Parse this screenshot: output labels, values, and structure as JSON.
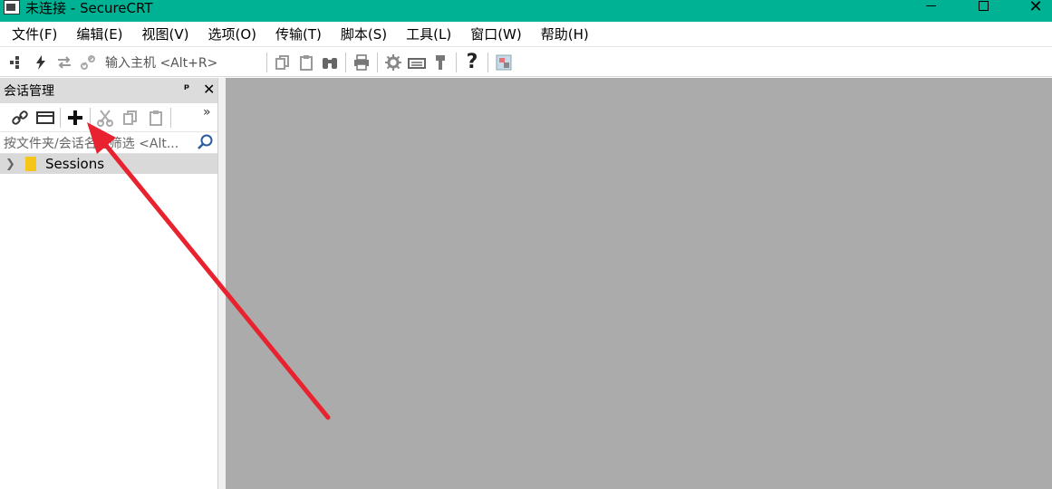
{
  "window": {
    "title": "未连接 - SecureCRT"
  },
  "menu": [
    "文件(F)",
    "编辑(E)",
    "视图(V)",
    "选项(O)",
    "传输(T)",
    "脚本(S)",
    "工具(L)",
    "窗口(W)",
    "帮助(H)"
  ],
  "toolbar": {
    "host_placeholder": "输入主机 <Alt+R>",
    "help_glyph": "?"
  },
  "session_panel": {
    "title": "会话管理",
    "pin_glyph": "ᵖ",
    "close_glyph": "✕",
    "more_glyph": "»",
    "filter_placeholder": "按文件夹/会话名称筛选 <Alt...",
    "tree": [
      {
        "label": "Sessions"
      }
    ]
  },
  "colors": {
    "titlebar": "#00b294",
    "workspace": "#ababab",
    "annotation_arrow": "#e8222e"
  },
  "icons": [
    "connect-icon",
    "flash-icon",
    "reconnect-icon",
    "disconnect-icon",
    "copy-icon",
    "paste-icon",
    "find-icon",
    "print-icon",
    "settings-icon",
    "keymap-icon",
    "key-icon",
    "help-icon",
    "log-icon",
    "link-icon",
    "window-icon",
    "plus-icon",
    "cut-icon"
  ]
}
